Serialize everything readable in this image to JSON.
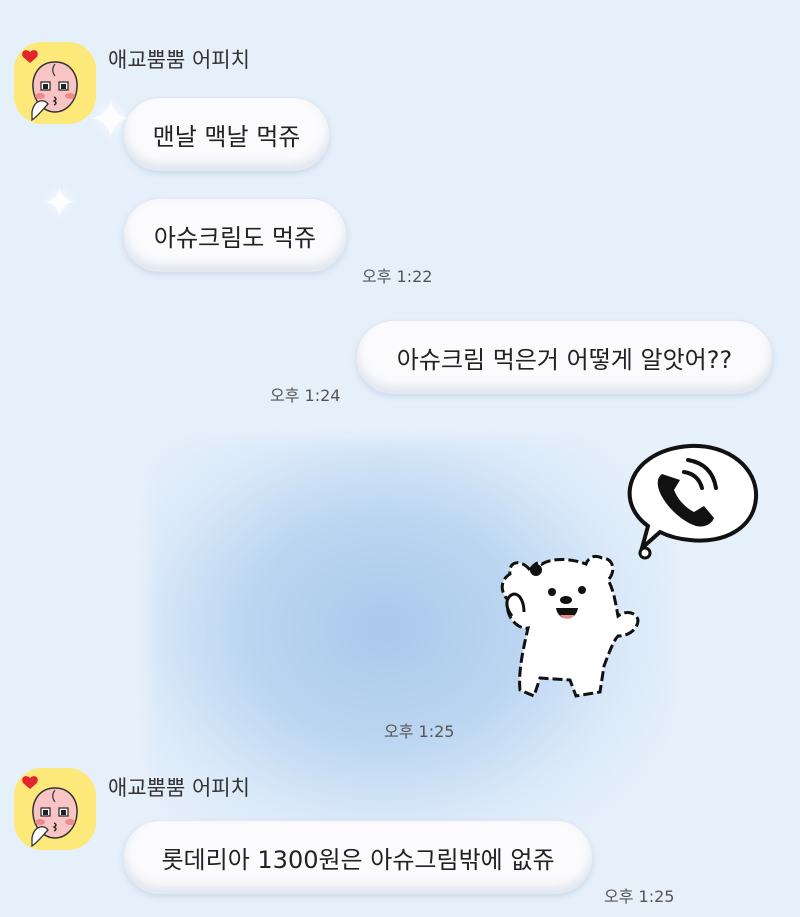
{
  "messages": [
    {
      "sender": "애교뿜뿜 어피치",
      "avatar_icon": "apeach-avatar-icon",
      "text": "맨날 맥날 먹쥬"
    },
    {
      "text": "아슈크림도 먹쥬",
      "time": "오후 1:22"
    },
    {
      "text": "아슈크림 먹은거 어떻게 알앗어??",
      "time": "오후 1:24"
    },
    {
      "sticker_icon": "bear-phone-sticker-icon",
      "time": "오후 1:25"
    },
    {
      "sender": "애교뿜뿜 어피치",
      "avatar_icon": "apeach-avatar-icon",
      "text": "롯데리아 1300원은 아슈그림밖에 없쥬",
      "time": "오후 1:25"
    }
  ],
  "colors": {
    "background": "#e6f0fb",
    "bubble": "#fbfbfd",
    "avatar_bg": "#fde97a"
  }
}
